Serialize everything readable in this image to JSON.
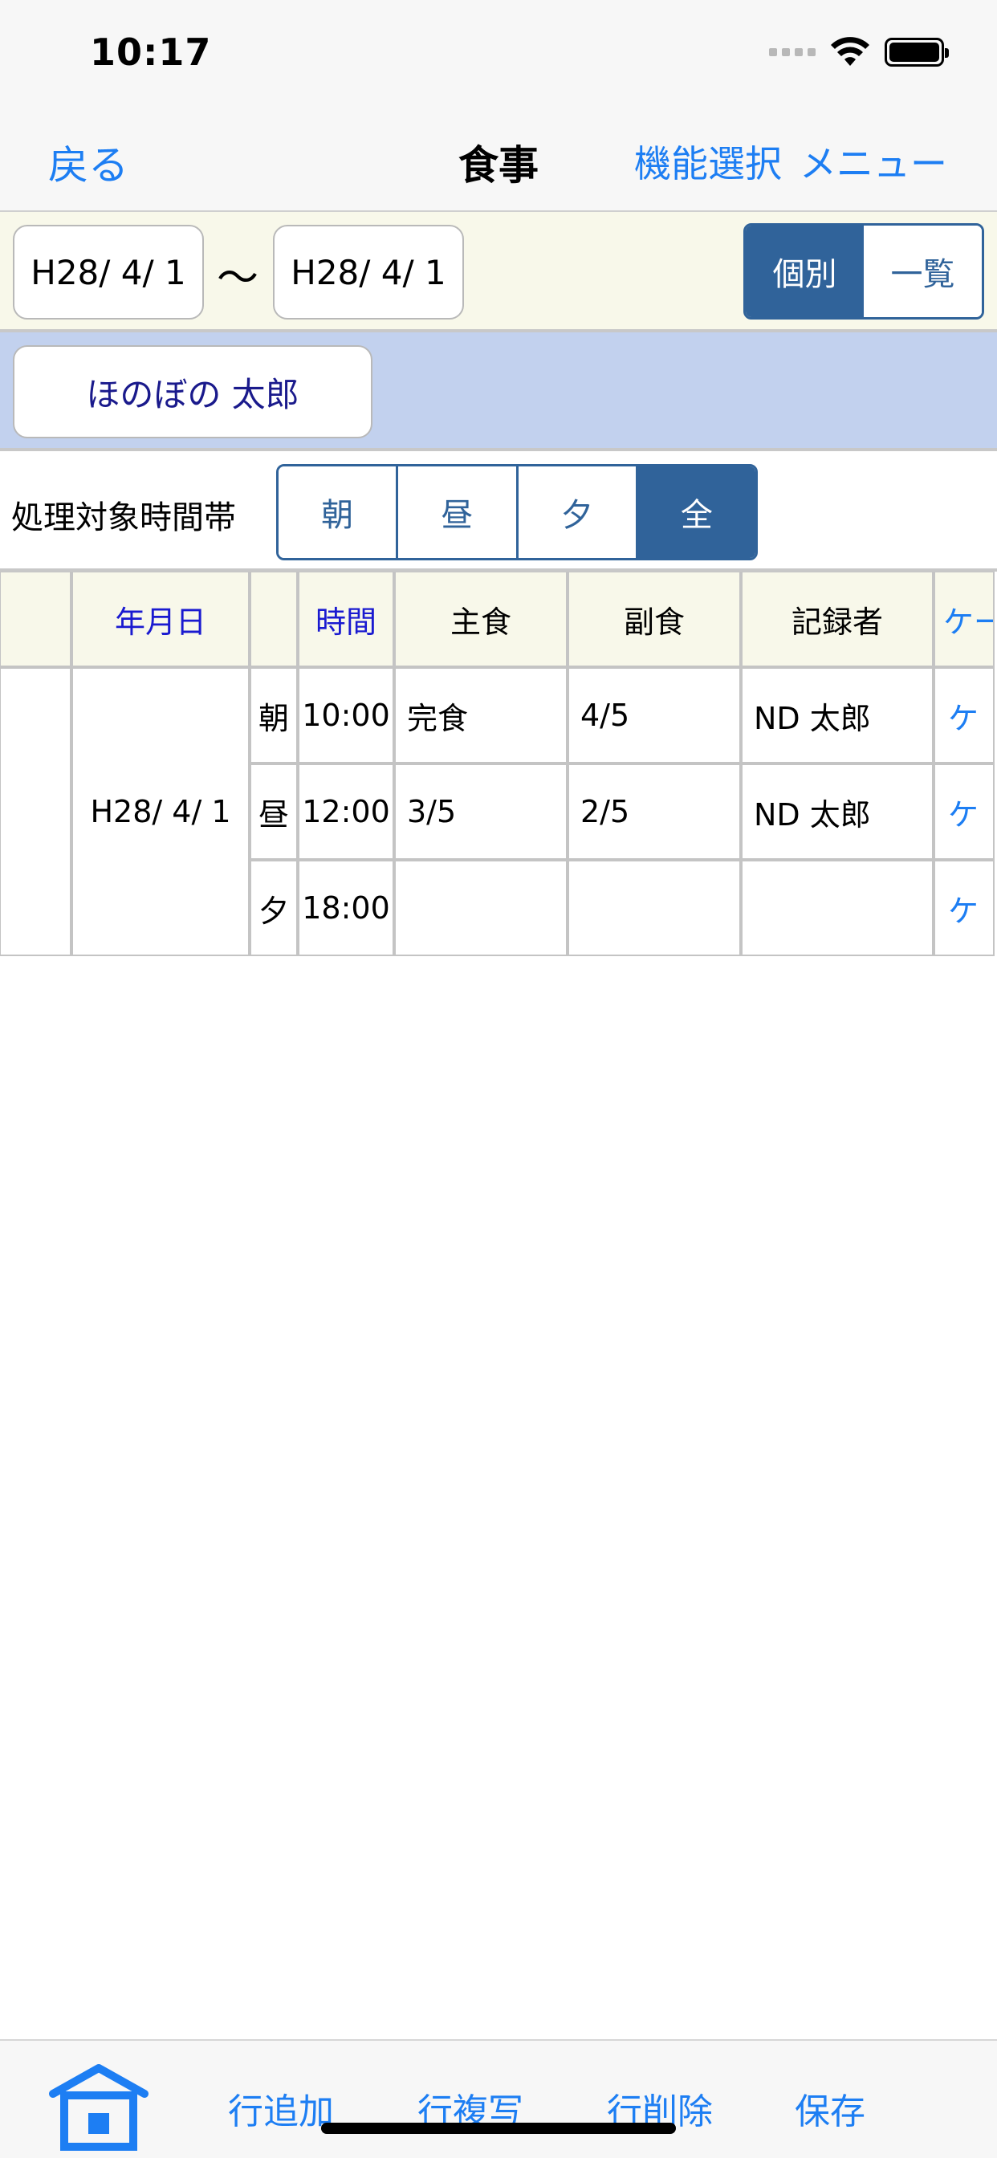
{
  "status_bar": {
    "time": "10:17"
  },
  "nav": {
    "back_label": "戻る",
    "title": "食事",
    "function_select_label": "機能選択",
    "menu_label": "メニュー"
  },
  "date_range": {
    "from": "H28/ 4/ 1",
    "separator": "〜",
    "to": "H28/ 4/ 1",
    "view_modes": [
      "個別",
      "一覧"
    ],
    "selected_view": "個別"
  },
  "person": {
    "name": "ほのぼの 太郎"
  },
  "time_filter": {
    "label": "処理対象時間帯",
    "options": [
      "朝",
      "昼",
      "夕",
      "全"
    ],
    "selected": "全"
  },
  "table": {
    "headers": {
      "blank": "",
      "date": "年月日",
      "period": "",
      "time": "時間",
      "staple": "主食",
      "side": "副食",
      "recorder": "記録者",
      "care": "ケー"
    },
    "date_value": "H28/ 4/ 1",
    "rows": [
      {
        "period": "朝",
        "time": "10:00",
        "staple": "完食",
        "side": "4/5",
        "recorder": "ND 太郎",
        "care": "ケ"
      },
      {
        "period": "昼",
        "time": "12:00",
        "staple": "3/5",
        "side": "2/5",
        "recorder": "ND 太郎",
        "care": "ケ"
      },
      {
        "period": "夕",
        "time": "18:00",
        "staple": "",
        "side": "",
        "recorder": "",
        "care": "ケ"
      }
    ]
  },
  "toolbar": {
    "home_icon": "home-icon",
    "add_row": "行追加",
    "copy_row": "行複写",
    "delete_row": "行削除",
    "save": "保存"
  },
  "colors": {
    "accent": "#1d7ef3",
    "segment": "#30639a",
    "header_bg": "#f8f8ea",
    "person_bg": "#c2d1ee"
  }
}
